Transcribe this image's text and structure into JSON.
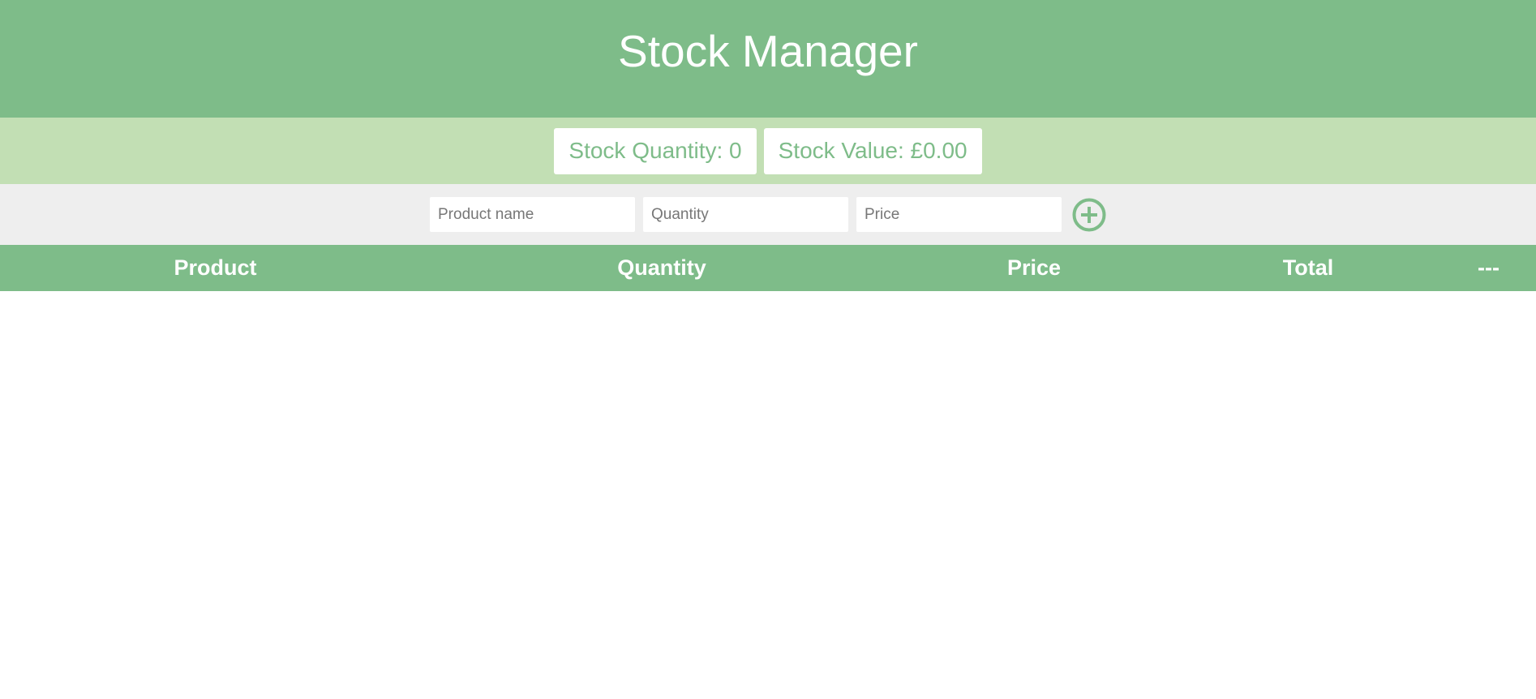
{
  "header": {
    "title": "Stock Manager"
  },
  "stats": {
    "quantity_label": "Stock Quantity: 0",
    "value_label": "Stock Value: £0.00"
  },
  "form": {
    "product_placeholder": "Product name",
    "quantity_placeholder": "Quantity",
    "price_placeholder": "Price",
    "add_icon": "plus-circle-icon"
  },
  "table": {
    "columns": [
      "Product",
      "Quantity",
      "Price",
      "Total",
      "---"
    ],
    "rows": []
  },
  "colors": {
    "primary": "#7ebc89",
    "secondary": "#c2dfb4",
    "form_background": "#eeeeee",
    "text_light": "#ffffff"
  }
}
